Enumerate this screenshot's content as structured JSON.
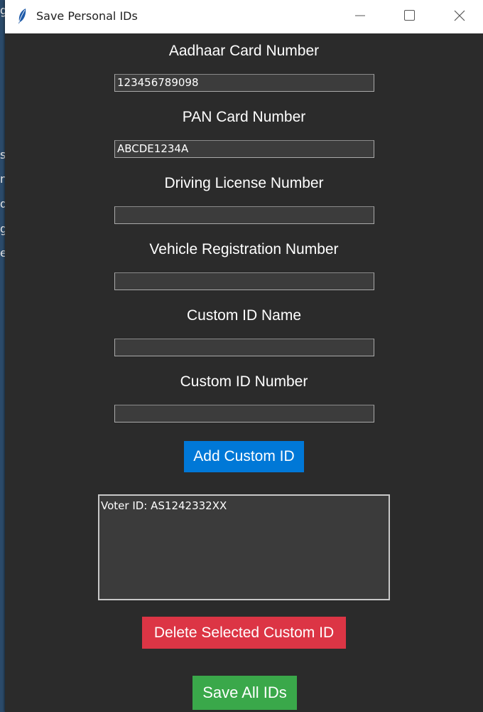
{
  "background_app": {
    "fragments": [
      "g",
      "s",
      "n",
      "d",
      "g",
      "e"
    ]
  },
  "window": {
    "title": "Save Personal IDs",
    "icon": "feather-icon",
    "controls": {
      "minimize_icon": "minimize-icon",
      "maximize_icon": "maximize-icon",
      "close_icon": "close-icon"
    }
  },
  "form": {
    "aadhaar": {
      "label": "Aadhaar Card Number",
      "value": "123456789098"
    },
    "pan": {
      "label": "PAN Card Number",
      "value": "ABCDE1234A"
    },
    "driving": {
      "label": "Driving License Number",
      "value": ""
    },
    "vehicle": {
      "label": "Vehicle Registration Number",
      "value": ""
    },
    "custom_name": {
      "label": "Custom ID Name",
      "value": ""
    },
    "custom_number": {
      "label": "Custom ID Number",
      "value": ""
    }
  },
  "buttons": {
    "add": "Add Custom ID",
    "delete": "Delete Selected Custom ID",
    "save": "Save All IDs"
  },
  "colors": {
    "add": "#0078d7",
    "delete": "#dc3545",
    "save": "#3aa84a",
    "background": "#2b2b2b"
  },
  "custom_ids": {
    "items": [
      "Voter ID: AS1242332XX"
    ]
  }
}
